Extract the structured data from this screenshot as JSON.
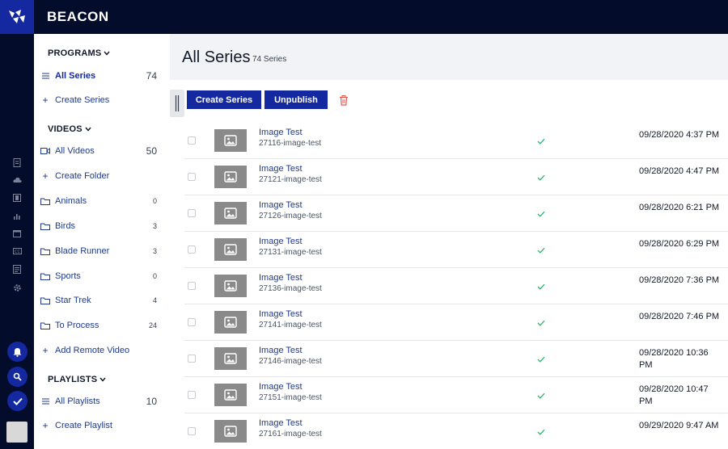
{
  "app": {
    "brand": "BEACON"
  },
  "colors": {
    "accent": "#1428a0",
    "topbar": "#040c2c",
    "check": "#2bb673",
    "trash": "#e05a4f"
  },
  "rail": {
    "icons": [
      "document-icon",
      "cloud-icon",
      "film-icon",
      "bar-chart-icon",
      "calendar-icon",
      "caption-icon",
      "list-document-icon",
      "gear-icon"
    ],
    "bottom": [
      "bell-icon",
      "search-icon",
      "checkmark-icon"
    ]
  },
  "sidebar": {
    "programs": {
      "header": "PROGRAMS",
      "items": [
        {
          "label": "All Series",
          "count": "74",
          "icon": "list-icon",
          "active": true
        },
        {
          "label": "Create Series",
          "count": "",
          "icon": "plus-icon"
        }
      ]
    },
    "videos": {
      "header": "VIDEOS",
      "items": [
        {
          "label": "All Videos",
          "count": "50",
          "icon": "video-icon"
        },
        {
          "label": "Create Folder",
          "count": "",
          "icon": "plus-icon"
        },
        {
          "label": "Animals",
          "count": "0",
          "icon": "folder-icon"
        },
        {
          "label": "Birds",
          "count": "3",
          "icon": "folder-icon"
        },
        {
          "label": "Blade Runner",
          "count": "3",
          "icon": "folder-icon"
        },
        {
          "label": "Sports",
          "count": "0",
          "icon": "folder-icon"
        },
        {
          "label": "Star Trek",
          "count": "4",
          "icon": "folder-icon"
        },
        {
          "label": "To Process",
          "count": "24",
          "icon": "folder-icon"
        },
        {
          "label": "Add Remote Video",
          "count": "",
          "icon": "plus-icon"
        }
      ]
    },
    "playlists": {
      "header": "PLAYLISTS",
      "items": [
        {
          "label": "All Playlists",
          "count": "10",
          "icon": "list-icon"
        },
        {
          "label": "Create Playlist",
          "count": "",
          "icon": "plus-icon"
        }
      ]
    }
  },
  "main": {
    "title": "All Series",
    "count_label": "74 Series",
    "buttons": {
      "create": "Create Series",
      "unpublish": "Unpublish"
    },
    "rows": [
      {
        "title": "Image Test",
        "slug": "27116-image-test",
        "date": "09/28/2020 4:37 PM"
      },
      {
        "title": "Image Test",
        "slug": "27121-image-test",
        "date": "09/28/2020 4:47 PM"
      },
      {
        "title": "Image Test",
        "slug": "27126-image-test",
        "date": "09/28/2020 6:21 PM"
      },
      {
        "title": "Image Test",
        "slug": "27131-image-test",
        "date": "09/28/2020 6:29 PM"
      },
      {
        "title": "Image Test",
        "slug": "27136-image-test",
        "date": "09/28/2020 7:36 PM"
      },
      {
        "title": "Image Test",
        "slug": "27141-image-test",
        "date": "09/28/2020 7:46 PM"
      },
      {
        "title": "Image Test",
        "slug": "27146-image-test",
        "date": "09/28/2020 10:36 PM"
      },
      {
        "title": "Image Test",
        "slug": "27151-image-test",
        "date": "09/28/2020 10:47 PM"
      },
      {
        "title": "Image Test",
        "slug": "27161-image-test",
        "date": "09/29/2020 9:47 AM"
      }
    ]
  }
}
